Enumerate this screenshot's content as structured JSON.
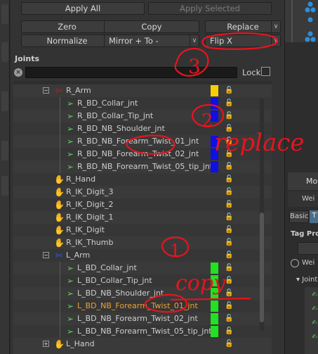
{
  "toolbar": {
    "apply_all": "Apply All",
    "apply_selected": "Apply Selected",
    "zero": "Zero",
    "copy": "Copy",
    "replace": "Replace",
    "normalize": "Normalize",
    "mirror": "Mirror + To -",
    "flip": "Flip X"
  },
  "joints": {
    "title": "Joints",
    "search_value": "",
    "lock_label": "Lock"
  },
  "rows": [
    {
      "name": "R_Arm",
      "icon": "red-arm-joint-icon",
      "swatch": "#f4d000"
    },
    {
      "name": "R_BD_Collar_jnt",
      "icon": "bone-joint-icon",
      "swatch": "#1010e0"
    },
    {
      "name": "R_BD_Collar_Tip_jnt",
      "icon": "bone-joint-icon",
      "swatch": "#1010e0"
    },
    {
      "name": "R_BD_NB_Shoulder_jnt",
      "icon": "bone-joint-icon",
      "swatch": ""
    },
    {
      "name": "R_BD_NB_Forearm_Twist_01_jnt",
      "icon": "bone-joint-icon",
      "swatch": "#1010e0"
    },
    {
      "name": "R_BD_NB_Forearm_Twist_02_jnt",
      "icon": "bone-joint-icon",
      "swatch": "#1010e0"
    },
    {
      "name": "R_BD_NB_Forearm_Twist_05_tip_jnt",
      "icon": "bone-joint-icon",
      "swatch": "#1010e0"
    },
    {
      "name": "R_Hand",
      "icon": "red-hand-joint-icon",
      "swatch": ""
    },
    {
      "name": "R_IK_Digit_3",
      "icon": "red-hand-joint-icon",
      "swatch": ""
    },
    {
      "name": "R_IK_Digit_2",
      "icon": "red-hand-joint-icon",
      "swatch": ""
    },
    {
      "name": "R_IK_Digit_1",
      "icon": "red-hand-joint-icon",
      "swatch": ""
    },
    {
      "name": "R_IK_Digit",
      "icon": "red-hand-joint-icon",
      "swatch": ""
    },
    {
      "name": "R_IK_Thumb",
      "icon": "red-hand-joint-icon",
      "swatch": ""
    },
    {
      "name": "L_Arm",
      "icon": "blue-arm-joint-icon",
      "swatch": ""
    },
    {
      "name": "L_BD_Collar_jnt",
      "icon": "bone-joint-icon",
      "swatch": "#22e022"
    },
    {
      "name": "L_BD_Collar_Tip_jnt",
      "icon": "bone-joint-icon",
      "swatch": "#22e022"
    },
    {
      "name": "L_BD_NB_Shoulder_jnt",
      "icon": "bone-joint-icon",
      "swatch": "#22e022"
    },
    {
      "name": "L_BD_NB_Forearm_Twist_01_jnt",
      "icon": "bone-joint-icon",
      "swatch": "#22e022",
      "highlight": true
    },
    {
      "name": "L_BD_NB_Forearm_Twist_02_jnt",
      "icon": "bone-joint-icon",
      "swatch": "#22e022"
    },
    {
      "name": "L_BD_NB_Forearm_Twist_05_tip_jnt",
      "icon": "bone-joint-icon",
      "swatch": "#22e022"
    },
    {
      "name": "L_Hand",
      "icon": "blue-hand-joint-icon",
      "swatch": ""
    }
  ],
  "right_panel": {
    "tab": "Mo",
    "sub": "Wei",
    "basic": "Basic",
    "t": "T",
    "tag_props": "Tag Pro",
    "weight_radio": "Wei",
    "joints_label": "Joint"
  },
  "annotations": {
    "note_replace": "replace",
    "note_copy": "copy",
    "num_1": "1",
    "num_2": "2",
    "num_3": "3",
    "color": "#e8141e"
  }
}
